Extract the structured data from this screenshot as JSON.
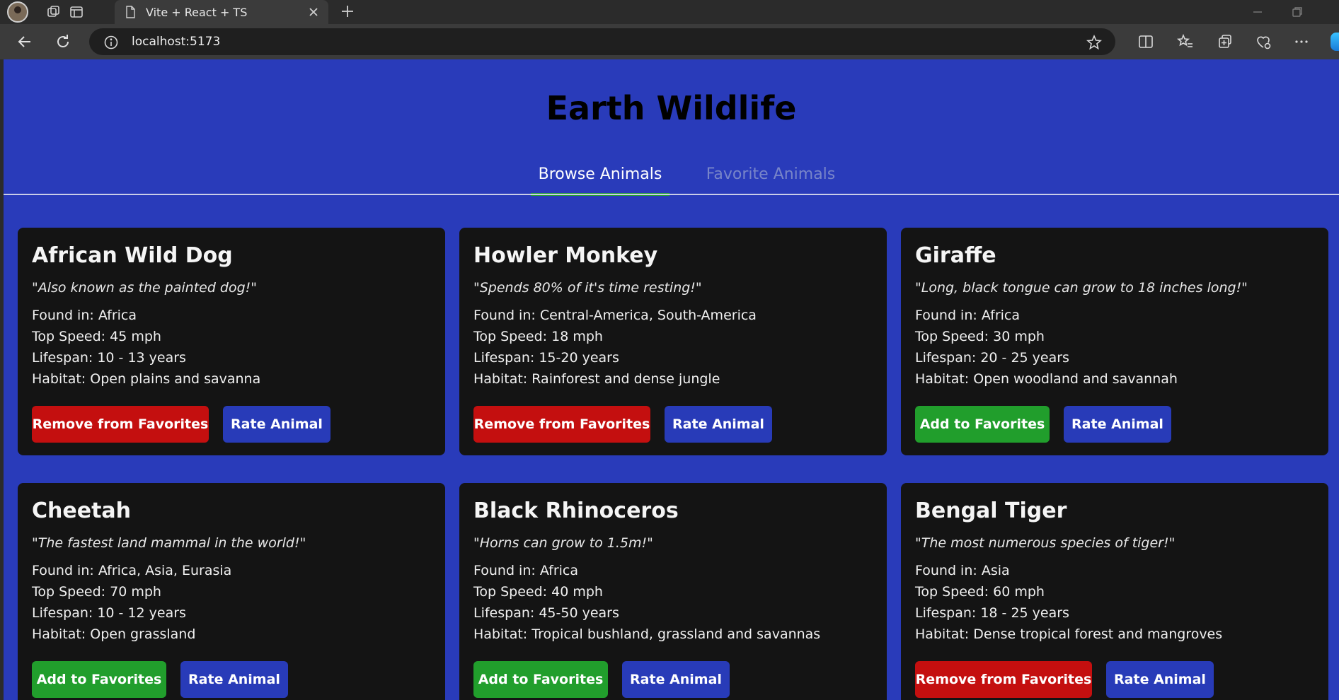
{
  "browser": {
    "tab_title": "Vite + React + TS",
    "url": "localhost:5173"
  },
  "app": {
    "title": "Earth Wildlife",
    "tabs": [
      {
        "label": "Browse Animals",
        "active": true
      },
      {
        "label": "Favorite Animals",
        "active": false
      }
    ]
  },
  "labels": {
    "found_prefix": "Found in: ",
    "speed_prefix": "Top Speed: ",
    "lifespan_prefix": "Lifespan: ",
    "habitat_prefix": "Habitat: ",
    "remove_favorite": "Remove from Favorites",
    "add_favorite": "Add to Favorites",
    "rate": "Rate Animal"
  },
  "colors": {
    "page_bg": "#293bba",
    "card_bg": "#141414",
    "remove_btn": "#c40f0f",
    "add_btn": "#219e2c",
    "rate_btn": "#283bb8",
    "active_tab_underline": "#24a232"
  },
  "animals": [
    {
      "name": "African Wild Dog",
      "quote": "\"Also known as the painted dog!\"",
      "found": "Africa",
      "speed": "45 mph",
      "lifespan": "10 - 13 years",
      "habitat": "Open plains and savanna",
      "favorite": true
    },
    {
      "name": "Howler Monkey",
      "quote": "\"Spends 80% of it's time resting!\"",
      "found": "Central-America, South-America",
      "speed": "18 mph",
      "lifespan": "15-20 years",
      "habitat": "Rainforest and dense jungle",
      "favorite": true
    },
    {
      "name": "Giraffe",
      "quote": "\"Long, black tongue can grow to 18 inches long!\"",
      "found": "Africa",
      "speed": "30 mph",
      "lifespan": "20 - 25 years",
      "habitat": "Open woodland and savannah",
      "favorite": false
    },
    {
      "name": "Cheetah",
      "quote": "\"The fastest land mammal in the world!\"",
      "found": "Africa, Asia, Eurasia",
      "speed": "70 mph",
      "lifespan": "10 - 12 years",
      "habitat": "Open grassland",
      "favorite": false
    },
    {
      "name": "Black Rhinoceros",
      "quote": "\"Horns can grow to 1.5m!\"",
      "found": "Africa",
      "speed": "40 mph",
      "lifespan": "45-50 years",
      "habitat": "Tropical bushland, grassland and savannas",
      "favorite": false
    },
    {
      "name": "Bengal Tiger",
      "quote": "\"The most numerous species of tiger!\"",
      "found": "Asia",
      "speed": "60 mph",
      "lifespan": "18 - 25 years",
      "habitat": "Dense tropical forest and mangroves",
      "favorite": true
    }
  ]
}
